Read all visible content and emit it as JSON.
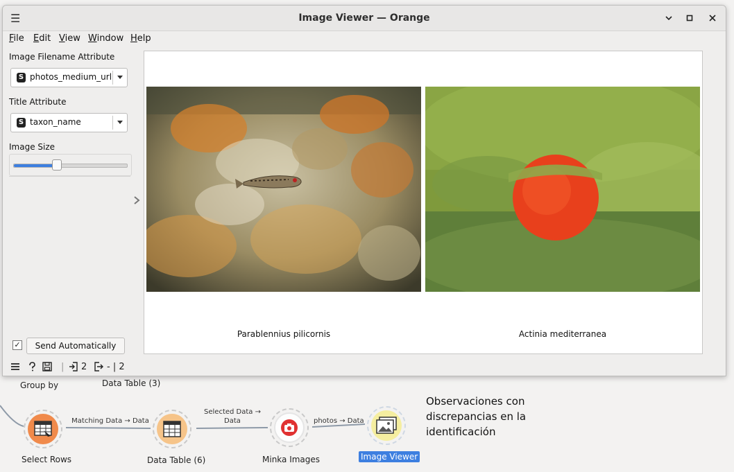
{
  "window": {
    "title": "Image Viewer — Orange",
    "controls": {
      "minimize": "▾",
      "maximize": "▫",
      "close": "✕"
    }
  },
  "menu": [
    "File",
    "Edit",
    "View",
    "Window",
    "Help"
  ],
  "settings": {
    "image_filename_label": "Image Filename Attribute",
    "image_filename_value": "photos_medium_url",
    "title_attr_label": "Title Attribute",
    "title_attr_value": "taxon_name",
    "image_size_label": "Image Size",
    "image_size_fraction": 0.38,
    "type_badge": "S"
  },
  "images": [
    {
      "caption": "Parablennius pilicornis"
    },
    {
      "caption": "Actinia mediterranea"
    }
  ],
  "commit": {
    "send_automatically_label": "Send Automatically",
    "checked_mark": "✓"
  },
  "status": {
    "input_count": "2",
    "output_count": "- | 2"
  },
  "canvas": {
    "group_by_label": "Group by",
    "data_table_3_label": "Data Table (3)",
    "nodes": [
      {
        "label": "Select Rows"
      },
      {
        "label": "Data Table (6)"
      },
      {
        "label": "Minka Images"
      },
      {
        "label": "Image Viewer"
      }
    ],
    "links": [
      {
        "label": "Matching Data → Data"
      },
      {
        "label": "Selected Data →\nData"
      },
      {
        "label": "photos → Data"
      }
    ],
    "annotation": "Observaciones con discrepancias en la identificación"
  },
  "colors": {
    "selection": "#3d7fe0",
    "node_orange": "#f4a261",
    "node_yellow": "#f6e58d",
    "node_red": "#e03131"
  }
}
